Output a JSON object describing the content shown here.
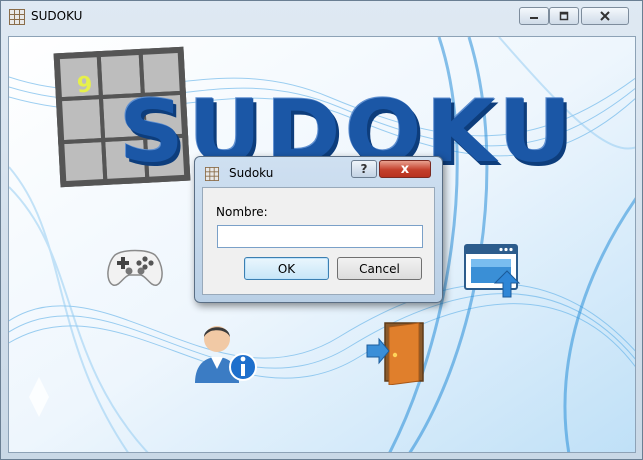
{
  "window": {
    "title": "SUDOKU",
    "icon": "grid-icon",
    "controls": {
      "minimize": "minimize-icon",
      "maximize": "maximize-icon",
      "close": "close-icon"
    }
  },
  "main": {
    "logo_text": "SUDOKU",
    "board_digit": "9",
    "icons": {
      "play": "gamepad-icon",
      "settings": "window-settings-icon",
      "about": "user-info-icon",
      "exit": "exit-door-icon"
    }
  },
  "dialog": {
    "title": "Sudoku",
    "help_label": "?",
    "close_label": "x",
    "field_label": "Nombre:",
    "input_value": "",
    "input_placeholder": "",
    "ok_label": "OK",
    "cancel_label": "Cancel"
  },
  "colors": {
    "logo_blue": "#1b57a6",
    "close_red": "#c4402c",
    "accent_light_blue": "#3c7fb1"
  }
}
